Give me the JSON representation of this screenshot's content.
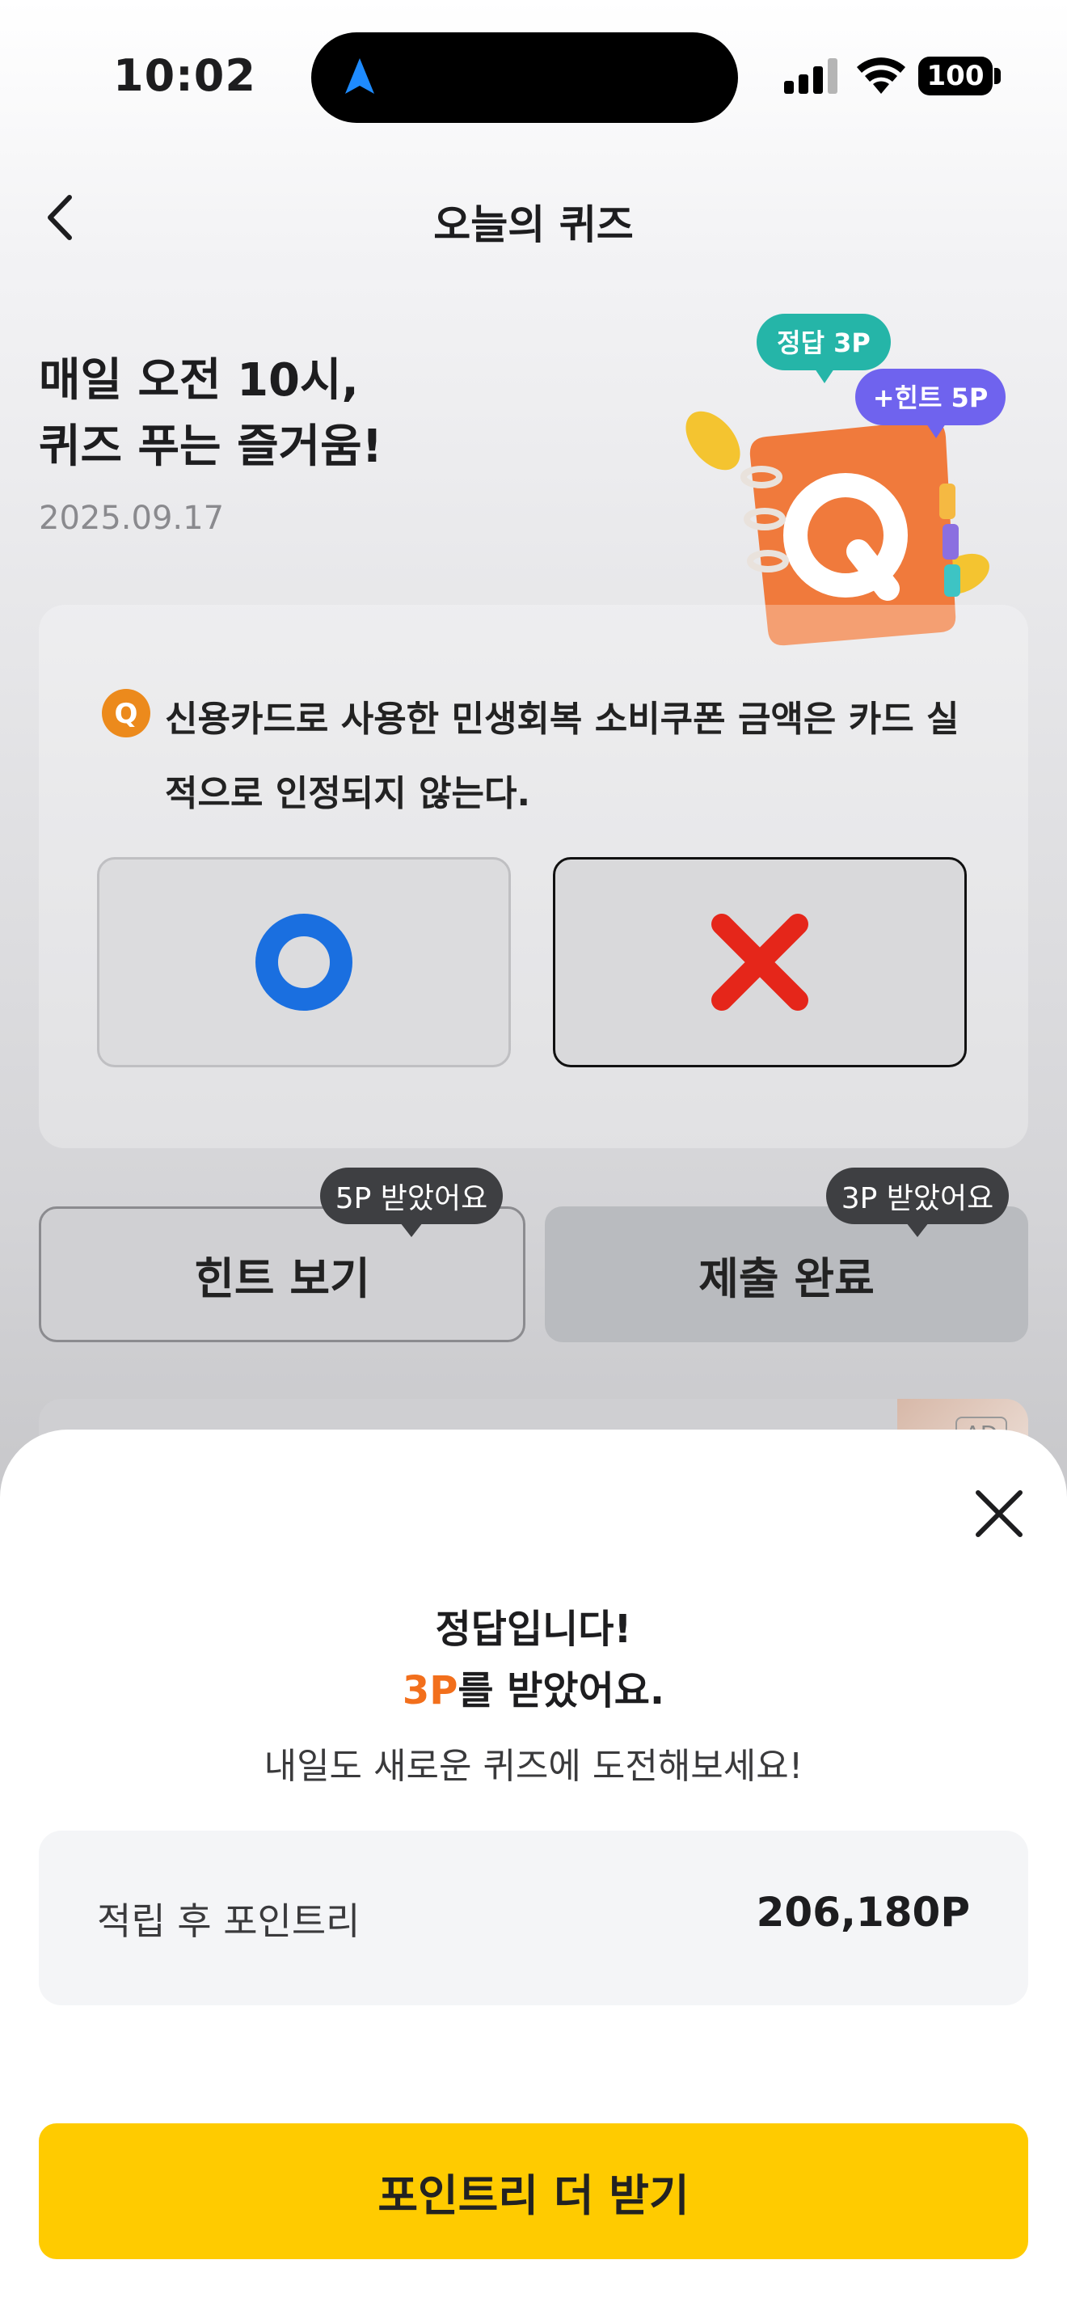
{
  "status": {
    "time": "10:02",
    "battery": "100"
  },
  "header": {
    "title": "오늘의 퀴즈"
  },
  "hero": {
    "title_line1": "매일 오전 10시,",
    "title_line2": "퀴즈 푸는 즐거움!",
    "date": "2025.09.17",
    "badge_correct": "정답 3P",
    "badge_hint": "+힌트 5P",
    "book_letter": "Q"
  },
  "quiz": {
    "q_badge": "Q",
    "question": "신용카드로 사용한 민생회복 소비쿠폰 금액은 카드 실적으로 인정되지 않는다."
  },
  "actions": {
    "hint_label": "힌트 보기",
    "hint_tip": "5P 받았어요",
    "submit_label": "제출 완료",
    "submit_tip": "3P 받았어요"
  },
  "ad": {
    "label": "AD"
  },
  "sheet": {
    "title": "정답입니다!",
    "points_earned": "3P",
    "points_suffix": "를 받았어요.",
    "description": "내일도 새로운 퀴즈에 도전해보세요!",
    "balance_label": "적립 후 포인트리",
    "balance_value": "206,180P",
    "cta_label": "포인트리 더 받기"
  },
  "colors": {
    "accent_yellow": "#ffcb00",
    "points_orange": "#f26f1c",
    "o_blue": "#1a6fe0",
    "x_red": "#e5261a"
  }
}
